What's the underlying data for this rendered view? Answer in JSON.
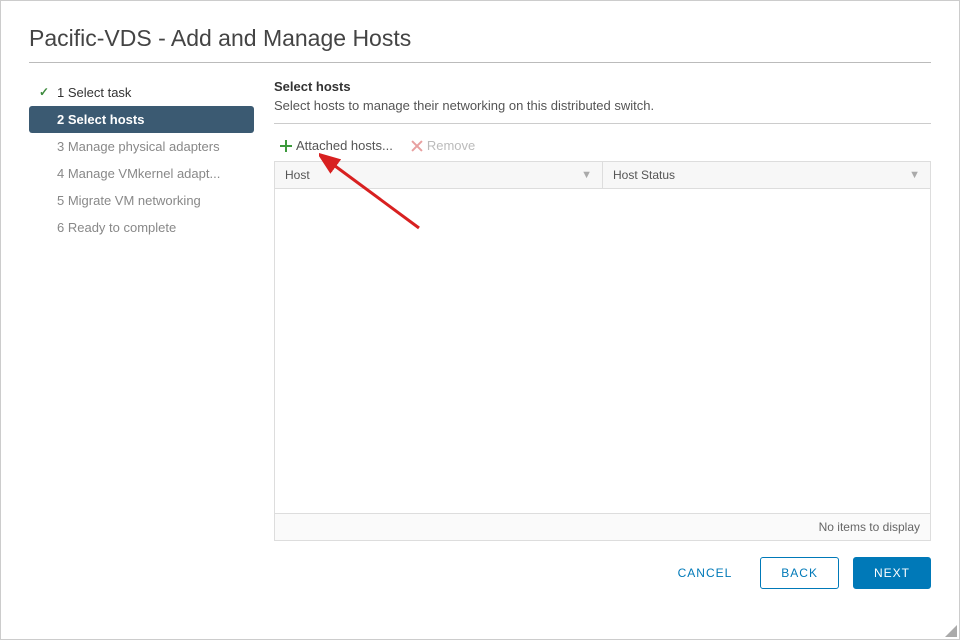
{
  "title": "Pacific-VDS - Add and Manage Hosts",
  "steps": [
    {
      "label": "1 Select task"
    },
    {
      "label": "2 Select hosts"
    },
    {
      "label": "3 Manage physical adapters"
    },
    {
      "label": "4 Manage VMkernel adapt..."
    },
    {
      "label": "5 Migrate VM networking"
    },
    {
      "label": "6 Ready to complete"
    }
  ],
  "content": {
    "heading": "Select hosts",
    "subheading": "Select hosts to manage their networking on this distributed switch."
  },
  "toolbar": {
    "add": "Attached hosts...",
    "remove": "Remove"
  },
  "columns": {
    "host": "Host",
    "status": "Host Status"
  },
  "grid": {
    "empty": "No items to display"
  },
  "footer": {
    "cancel": "CANCEL",
    "back": "BACK",
    "next": "NEXT"
  }
}
